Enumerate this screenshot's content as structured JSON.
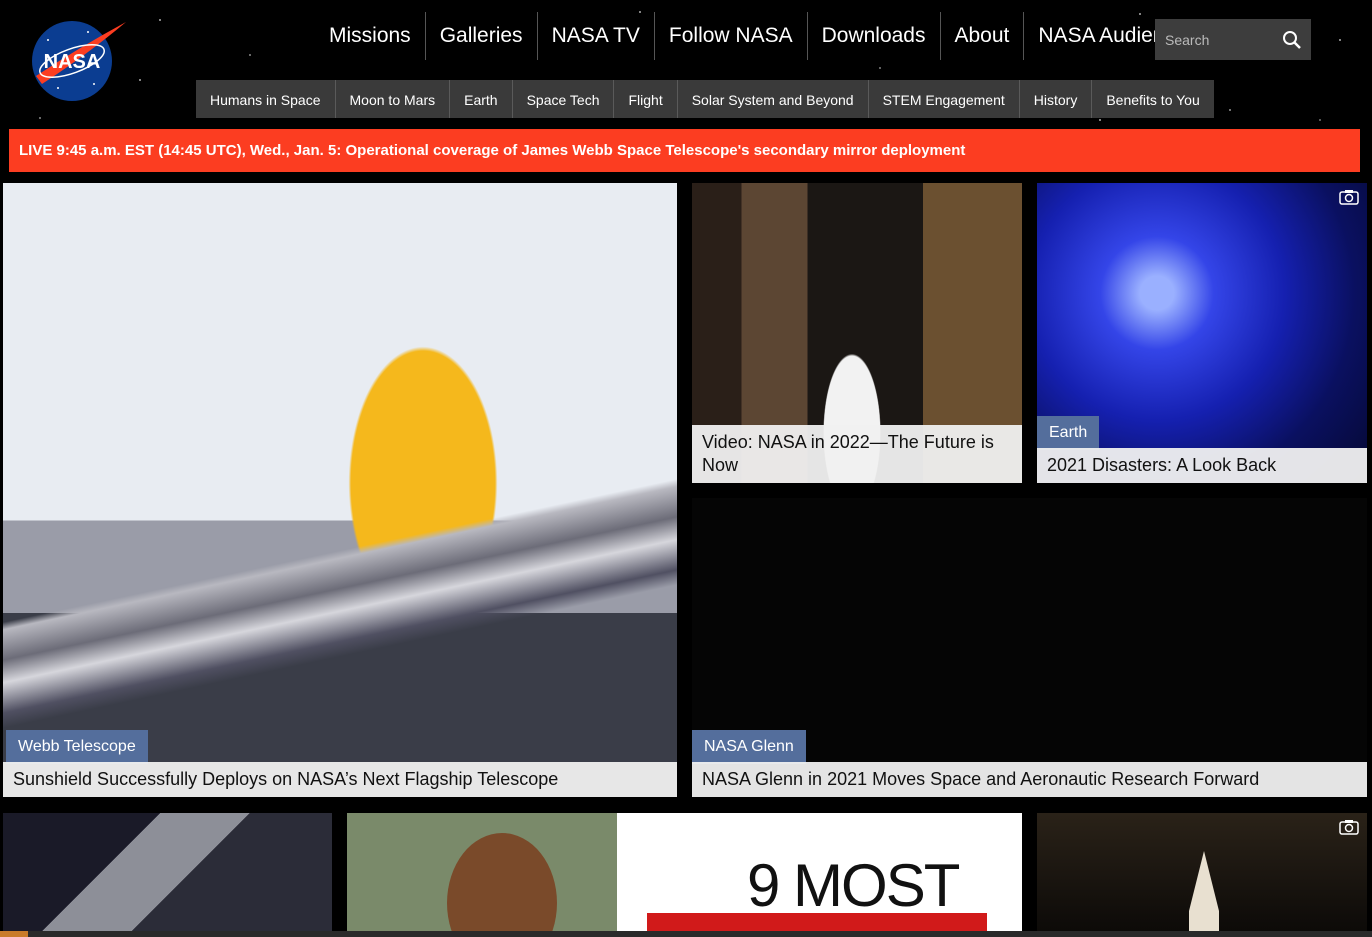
{
  "logo": {
    "text": "NASA"
  },
  "main_nav": [
    {
      "label": "Missions"
    },
    {
      "label": "Galleries"
    },
    {
      "label": "NASA TV"
    },
    {
      "label": "Follow NASA"
    },
    {
      "label": "Downloads"
    },
    {
      "label": "About"
    },
    {
      "label": "NASA Audiences"
    }
  ],
  "search": {
    "placeholder": "Search"
  },
  "sub_nav": [
    {
      "label": "Humans in Space"
    },
    {
      "label": "Moon to Mars"
    },
    {
      "label": "Earth"
    },
    {
      "label": "Space Tech"
    },
    {
      "label": "Flight"
    },
    {
      "label": "Solar System and Beyond"
    },
    {
      "label": "STEM Engagement"
    },
    {
      "label": "History"
    },
    {
      "label": "Benefits to You"
    }
  ],
  "live_banner": {
    "text": "LIVE 9:45 a.m. EST (14:45 UTC), Wed., Jan. 5: Operational coverage of James Webb Space Telescope's secondary mirror deployment"
  },
  "cards": {
    "webb": {
      "category": "Webb Telescope",
      "title": "Sunshield Successfully Deploys on NASA’s Next Flagship Telescope"
    },
    "future": {
      "title": "Video: NASA in 2022—The Future is Now"
    },
    "disasters": {
      "category": "Earth",
      "title": "2021 Disasters: A Look Back"
    },
    "glenn": {
      "category": "NASA Glenn",
      "title": "NASA Glenn in 2021 Moves Space and Aeronautic Research Forward"
    },
    "memorable": {
      "headline": "9 MOST"
    }
  },
  "colors": {
    "accent": "#fc3d21",
    "category": "#546e9c",
    "nav_bg": "#3a3a3a"
  }
}
